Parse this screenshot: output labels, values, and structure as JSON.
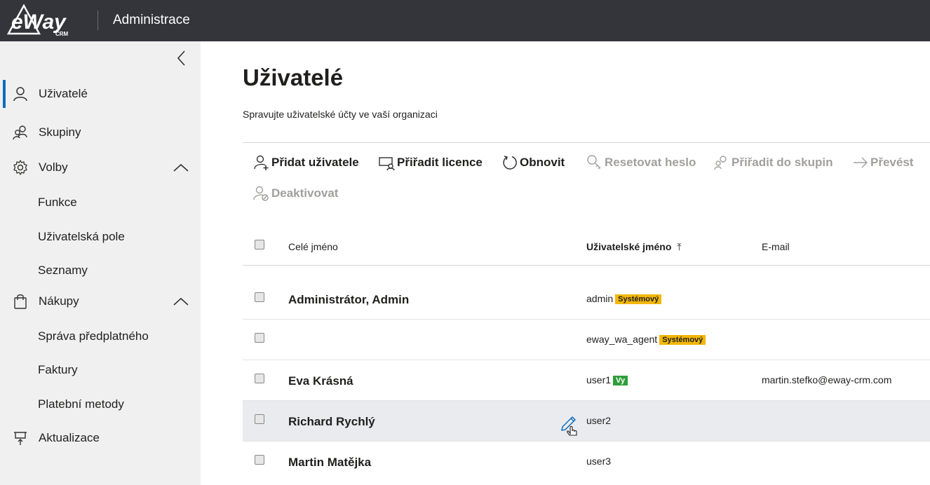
{
  "app": {
    "logo_text": "eWay",
    "logo_sub": "CRM",
    "title": "Administrace"
  },
  "sidebar": {
    "items": [
      {
        "label": "Uživatelé",
        "icon": "user-icon"
      },
      {
        "label": "Skupiny",
        "icon": "group-icon"
      },
      {
        "label": "Volby",
        "icon": "gear-icon"
      },
      {
        "label": "Funkce"
      },
      {
        "label": "Uživatelská pole"
      },
      {
        "label": "Seznamy"
      },
      {
        "label": "Nákupy",
        "icon": "shopping-bag-icon"
      },
      {
        "label": "Správa předplatného"
      },
      {
        "label": "Faktury"
      },
      {
        "label": "Platební metody"
      },
      {
        "label": "Aktualizace",
        "icon": "update-icon"
      }
    ]
  },
  "page": {
    "title": "Uživatelé",
    "subtitle": "Spravujte uživatelské účty ve vaší organizaci"
  },
  "commands": [
    {
      "label": "Přidat uživatele",
      "enabled": true,
      "icon": "add-user-icon"
    },
    {
      "label": "Přiřadit licence",
      "enabled": true,
      "icon": "assign-license-icon"
    },
    {
      "label": "Obnovit",
      "enabled": true,
      "icon": "refresh-icon"
    },
    {
      "label": "Resetovat heslo",
      "enabled": false,
      "icon": "reset-password-icon"
    },
    {
      "label": "Přiřadit do skupin",
      "enabled": false,
      "icon": "assign-group-icon"
    },
    {
      "label": "Převést",
      "enabled": false,
      "icon": "arrow-right-icon"
    },
    {
      "label": "Deaktivovat",
      "enabled": false,
      "icon": "deactivate-user-icon"
    }
  ],
  "table": {
    "columns": [
      "Celé jméno",
      "Uživatelské jméno",
      "E-mail"
    ],
    "sort_indicator": "⤒",
    "rows": [
      {
        "full_name": "Administrátor, Admin",
        "username": "admin",
        "badge": "Systémový",
        "email": ""
      },
      {
        "full_name": "",
        "username": "eway_wa_agent",
        "badge": "Systémový",
        "email": ""
      },
      {
        "full_name": "Eva Krásná",
        "username": "user1",
        "badge": "Vy",
        "email": "martin.stefko@eway-crm.com"
      },
      {
        "full_name": "Richard Rychlý",
        "username": "user2",
        "badge": "",
        "email": ""
      },
      {
        "full_name": "Martin Matějka",
        "username": "user3",
        "badge": "",
        "email": ""
      }
    ]
  },
  "colors": {
    "topbar": "#33353a",
    "sidebar": "#f0f0f0",
    "accent": "#0f6cbd",
    "badge_system": "#f2b705",
    "badge_you": "#2e9e3a",
    "disabled_text": "#a19f9d"
  }
}
